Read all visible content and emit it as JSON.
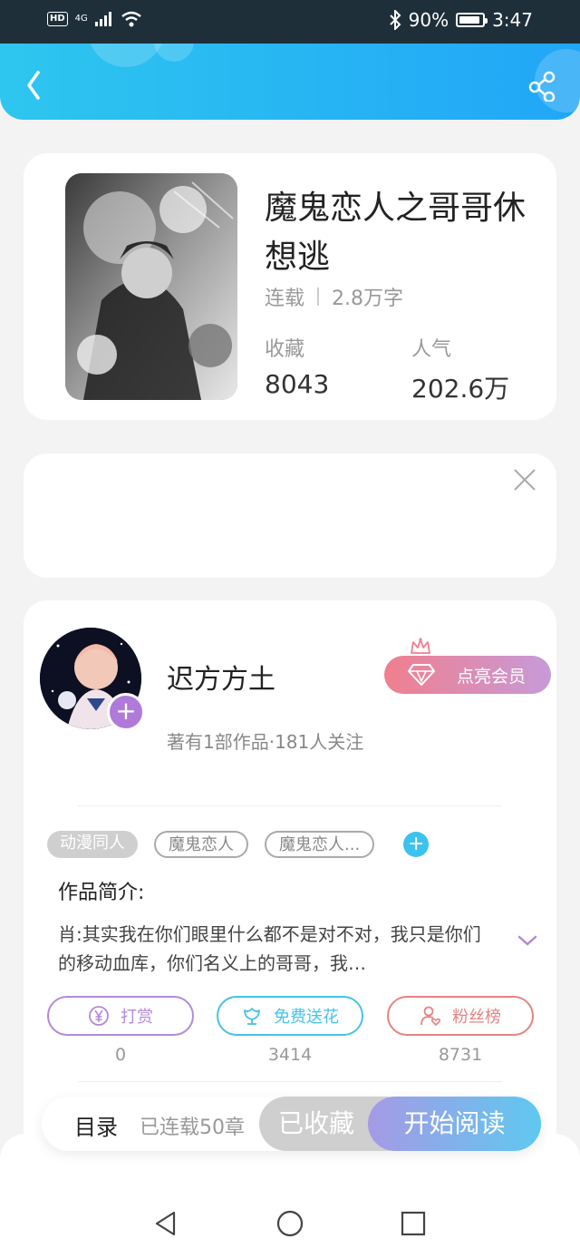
{
  "status_bar": {
    "hd": "HD",
    "network": "4G",
    "battery": "90%",
    "time": "3:47"
  },
  "book": {
    "title": "魔鬼恋人之哥哥休想逃",
    "status": "连载",
    "word_count": "2.8万字",
    "favorites_label": "收藏",
    "favorites_value": "8043",
    "popularity_label": "人气",
    "popularity_value": "202.6万"
  },
  "author": {
    "name": "迟方方土",
    "info": "著有1部作品·181人关注",
    "vip_label": "点亮会员",
    "follow_symbol": "+"
  },
  "tags": [
    "动漫同人",
    "魔鬼恋人",
    "魔鬼恋人..."
  ],
  "tag_add_symbol": "+",
  "intro": {
    "title": "作品简介:",
    "text": "肖:其实我在你们眼里什么都不是对不对，我只是你们的移动血库，你们名义上的哥哥，我…"
  },
  "actions": [
    {
      "label": "打赏",
      "count": "0",
      "color": "#b38ad8",
      "icon": "yen-coin-icon"
    },
    {
      "label": "免费送花",
      "count": "3414",
      "color": "#45c3e8",
      "icon": "flower-icon"
    },
    {
      "label": "粉丝榜",
      "count": "8731",
      "color": "#e88282",
      "icon": "fan-heart-icon"
    }
  ],
  "bottom_bar": {
    "toc_label": "目录",
    "chapters": "已连载50章",
    "favorited_label": "已收藏",
    "read_label": "开始阅读"
  },
  "colors": {
    "header_start": "#2ec6ef",
    "header_end": "#21a6f7",
    "accent_purple": "#b07ad8",
    "accent_blue": "#3cc2ef"
  }
}
